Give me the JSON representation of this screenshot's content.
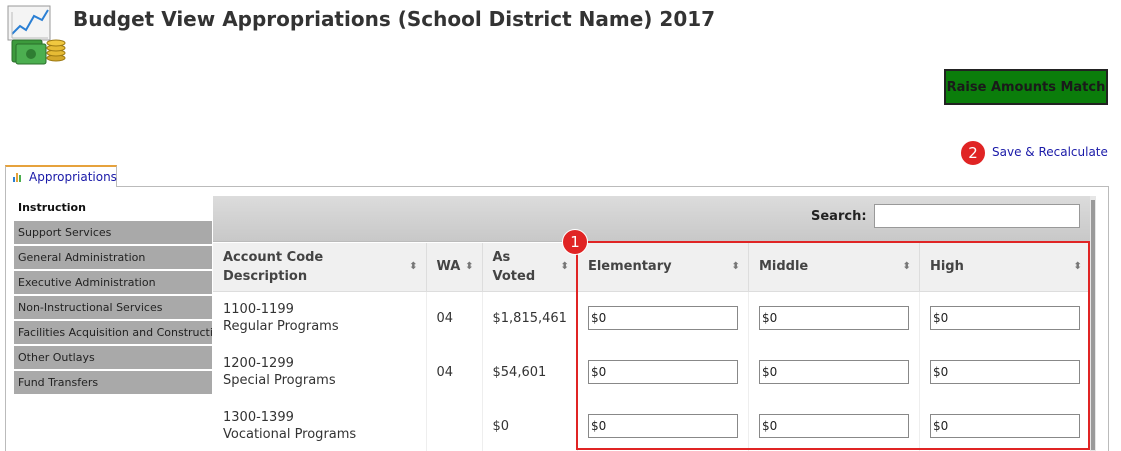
{
  "header": {
    "title": "Budget View Appropriations (School District Name) 2017"
  },
  "toolbar": {
    "raise_label": "Raise Amounts Match",
    "save_label": "Save & Recalculate",
    "badge_save": "2",
    "badge_table": "1"
  },
  "tab": {
    "label": "Appropriations"
  },
  "sidebar": {
    "items": [
      {
        "label": "Instruction"
      },
      {
        "label": "Support Services"
      },
      {
        "label": "General Administration"
      },
      {
        "label": "Executive Administration"
      },
      {
        "label": "Non-Instructional Services"
      },
      {
        "label": "Facilities Acquisition and Construction"
      },
      {
        "label": "Other Outlays"
      },
      {
        "label": "Fund Transfers"
      }
    ]
  },
  "search": {
    "label": "Search:",
    "value": ""
  },
  "table": {
    "headers": {
      "account": "Account Code Description",
      "wa": "WA",
      "voted": "As Voted",
      "elementary": "Elementary",
      "middle": "Middle",
      "high": "High"
    },
    "rows": [
      {
        "code": "1100-1199",
        "desc": "Regular Programs",
        "wa": "04",
        "voted": "$1,815,461",
        "elementary": "$0",
        "middle": "$0",
        "high": "$0"
      },
      {
        "code": "1200-1299",
        "desc": "Special Programs",
        "wa": "04",
        "voted": "$54,601",
        "elementary": "$0",
        "middle": "$0",
        "high": "$0"
      },
      {
        "code": "1300-1399",
        "desc": "Vocational Programs",
        "wa": "",
        "voted": "$0",
        "elementary": "$0",
        "middle": "$0",
        "high": "$0"
      }
    ]
  },
  "colors": {
    "accent_green": "#0b7d0b",
    "highlight_red": "#e02424",
    "link_blue": "#1a1aa8"
  },
  "icons": {
    "logo": "money-chart-icon",
    "tab": "bar-chart-icon",
    "sort": "sort-arrows-icon"
  }
}
